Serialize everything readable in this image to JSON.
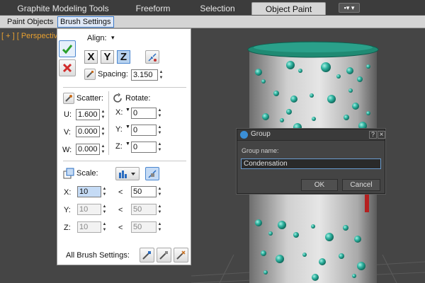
{
  "ribbon": {
    "tabs": [
      {
        "label": "Graphite Modeling Tools"
      },
      {
        "label": "Freeform"
      },
      {
        "label": "Selection"
      },
      {
        "label": "Object Paint"
      }
    ],
    "menu_glyph": "▪▾ ▾"
  },
  "subtabs": [
    {
      "label": "Paint Objects"
    },
    {
      "label": "Brush Settings"
    }
  ],
  "viewport": {
    "label": "[ + ] [ Perspective"
  },
  "panel": {
    "align_label": "Align:",
    "align_arrow": "▾",
    "axes": [
      "X",
      "Y",
      "Z"
    ],
    "active_axis": "Z",
    "spacing_label": "Spacing:",
    "spacing_value": "3.150",
    "scatter_label": "Scatter:",
    "rotate_label": "Rotate:",
    "scatter": [
      {
        "label": "U:",
        "value": "1.600"
      },
      {
        "label": "V:",
        "value": "0.000"
      },
      {
        "label": "W:",
        "value": "0.000"
      }
    ],
    "rotate": [
      {
        "label": "X:",
        "value": "0"
      },
      {
        "label": "Y:",
        "value": "0"
      },
      {
        "label": "Z:",
        "value": "0"
      }
    ],
    "scale_label": "Scale:",
    "scale": [
      {
        "label": "X:",
        "min": "10",
        "sep": "<",
        "max": "50"
      },
      {
        "label": "Y:",
        "min": "10",
        "sep": "<",
        "max": "50"
      },
      {
        "label": "Z:",
        "min": "10",
        "sep": "<",
        "max": "50"
      }
    ],
    "all_brush_label": "All Brush Settings:"
  },
  "dialog": {
    "title": "Group",
    "help": "?",
    "close": "×",
    "field_label": "Group name:",
    "field_value": "Condensation",
    "ok": "OK",
    "cancel": "Cancel"
  },
  "colors": {
    "accent": "#3a79c9",
    "check_green": "#2aa02a",
    "cross_red": "#d12a2a",
    "bubble": "#2fb3a0",
    "can_lid": "#1f8a73"
  }
}
